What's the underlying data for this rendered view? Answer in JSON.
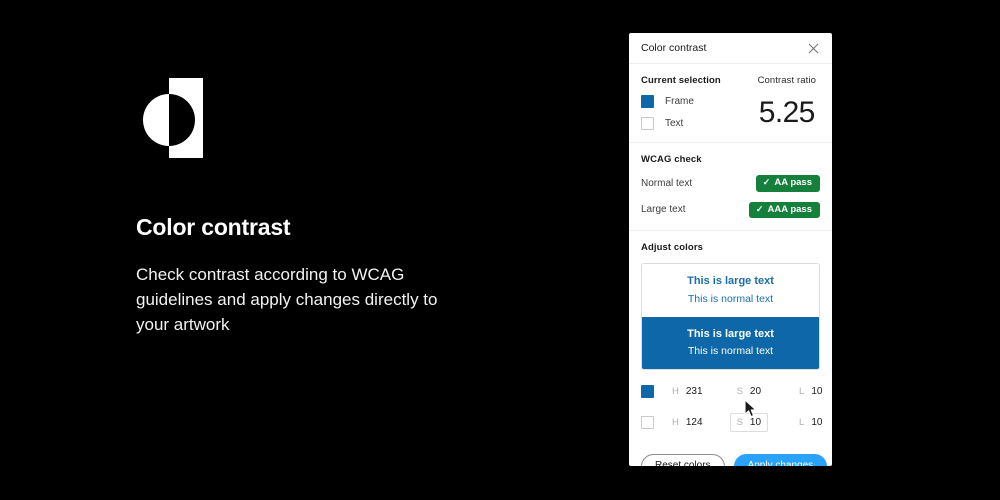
{
  "promo": {
    "logo_icon": "figma-plugin-logo-mark",
    "title": "Color contrast",
    "description": "Check contrast according to WCAG guidelines and apply changes directly to your artwork"
  },
  "panel": {
    "title": "Color contrast",
    "close_icon": "close-icon",
    "selection": {
      "label": "Current selection",
      "items": [
        {
          "label": "Frame",
          "checked": true,
          "swatch_color": "#0d67a8"
        },
        {
          "label": "Text",
          "checked": false,
          "swatch_color": "#ffffff"
        }
      ]
    },
    "contrast": {
      "label": "Contrast ratio",
      "value": "5.25"
    },
    "wcag": {
      "label": "WCAG check",
      "rows": [
        {
          "name": "Normal text",
          "badge": "AA pass",
          "badge_color": "#14803c",
          "tick_icon": "check-icon"
        },
        {
          "name": "Large text",
          "badge": "AAA pass",
          "badge_color": "#14803c",
          "tick_icon": "check-icon"
        }
      ]
    },
    "adjust": {
      "label": "Adjust colors",
      "preview": [
        {
          "background": "#ffffff",
          "text_color": "#1a6fae",
          "large_text": "This is large text",
          "normal_text": "This is normal text"
        },
        {
          "background": "#0d67a8",
          "text_color": "#ffffff",
          "large_text": "This is large text",
          "normal_text": "This is normal text"
        }
      ],
      "color_rows": [
        {
          "checked": true,
          "swatch_color": "#0d67a8",
          "h_key": "H",
          "h_value": "231",
          "s_key": "S",
          "s_value": "20",
          "l_key": "L",
          "l_value": "10",
          "hovered_field": ""
        },
        {
          "checked": false,
          "swatch_color": "#ffffff",
          "h_key": "H",
          "h_value": "124",
          "s_key": "S",
          "s_value": "10",
          "l_key": "L",
          "l_value": "10",
          "hovered_field": "S"
        }
      ]
    },
    "footer": {
      "reset_label": "Reset colors",
      "apply_label": "Apply changes",
      "apply_color": "#2aa2f7"
    }
  },
  "cursor": {
    "icon": "mouse-pointer-icon"
  }
}
